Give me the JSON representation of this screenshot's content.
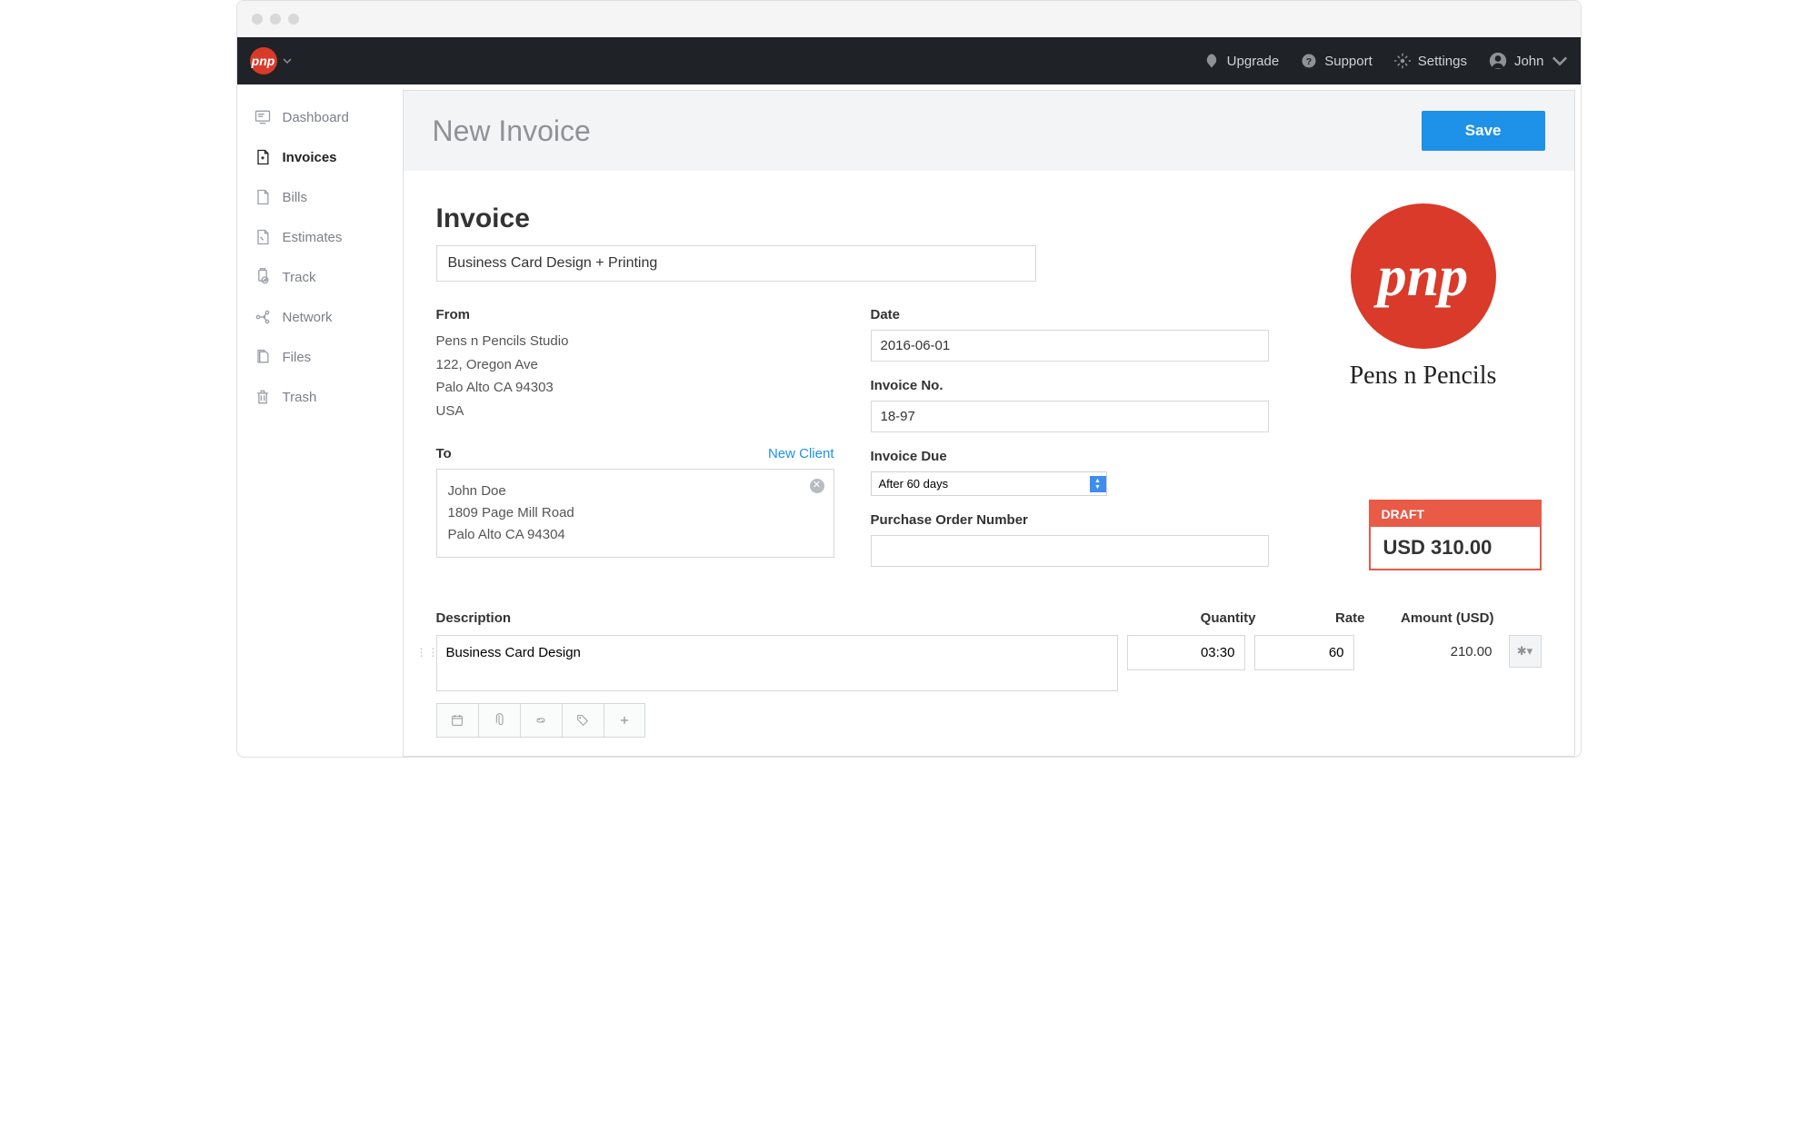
{
  "topbar": {
    "upgrade": "Upgrade",
    "support": "Support",
    "settings": "Settings",
    "user": "John"
  },
  "sidebar": {
    "items": [
      {
        "label": "Dashboard"
      },
      {
        "label": "Invoices"
      },
      {
        "label": "Bills"
      },
      {
        "label": "Estimates"
      },
      {
        "label": "Track"
      },
      {
        "label": "Network"
      },
      {
        "label": "Files"
      },
      {
        "label": "Trash"
      }
    ]
  },
  "header": {
    "title": "New Invoice",
    "save": "Save"
  },
  "invoice": {
    "heading": "Invoice",
    "title_value": "Business Card Design + Printing",
    "from_label": "From",
    "from": {
      "line1": "Pens n Pencils Studio",
      "line2": "122, Oregon Ave",
      "line3": "Palo Alto CA 94303",
      "line4": "USA"
    },
    "to_label": "To",
    "new_client": "New Client",
    "to": {
      "line1": "John Doe",
      "line2": "1809 Page Mill Road",
      "line3": "Palo Alto CA 94304"
    },
    "date_label": "Date",
    "date_value": "2016-06-01",
    "number_label": "Invoice No.",
    "number_value": "18-97",
    "due_label": "Invoice Due",
    "due_value": "After 60 days",
    "po_label": "Purchase Order Number",
    "po_value": ""
  },
  "company": {
    "logo_text": "pnp",
    "name": "Pens n Pencils"
  },
  "total": {
    "status": "DRAFT",
    "amount": "USD 310.00"
  },
  "line_items": {
    "headers": {
      "description": "Description",
      "quantity": "Quantity",
      "rate": "Rate",
      "amount": "Amount (USD)"
    },
    "rows": [
      {
        "description": "Business Card Design",
        "quantity": "03:30",
        "rate": "60",
        "amount": "210.00"
      }
    ]
  }
}
